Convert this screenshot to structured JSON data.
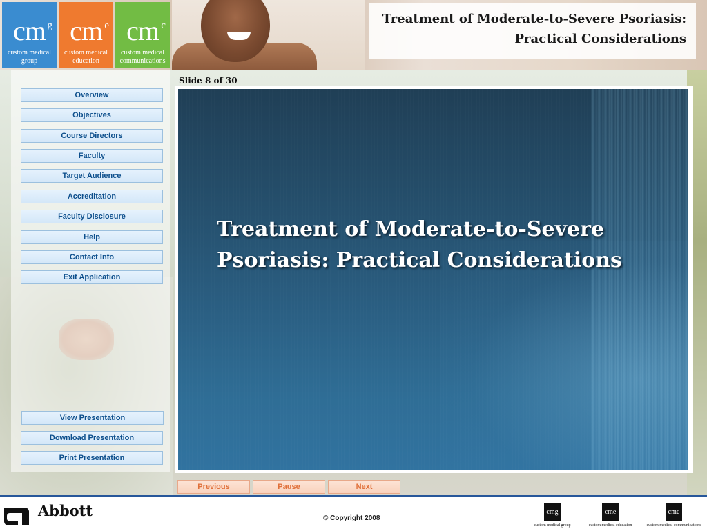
{
  "header": {
    "title_line1": "Treatment of Moderate-to-Severe Psoriasis:",
    "title_line2": "Practical Considerations",
    "logos": [
      {
        "mark": "cm",
        "sup": "g",
        "line1": "custom medical",
        "line2": "group",
        "color": "#3a8cd0"
      },
      {
        "mark": "cm",
        "sup": "e",
        "line1": "custom medical",
        "line2": "education",
        "color": "#ef7a2f"
      },
      {
        "mark": "cm",
        "sup": "c",
        "line1": "custom medical",
        "line2": "communications",
        "color": "#72bc44"
      }
    ]
  },
  "sidebar": {
    "nav": [
      "Overview",
      "Objectives",
      "Course Directors",
      "Faculty",
      "Target Audience",
      "Accreditation",
      "Faculty Disclosure",
      "Help",
      "Contact Info",
      "Exit Application"
    ],
    "actions": [
      "View Presentation",
      "Download Presentation",
      "Print Presentation"
    ]
  },
  "slide": {
    "counter": "Slide 8 of 30",
    "title_line1": "Treatment of Moderate-to-Severe",
    "title_line2": "Psoriasis: Practical Considerations"
  },
  "controls": {
    "previous": "Previous",
    "pause": "Pause",
    "next": "Next"
  },
  "footer": {
    "brand": "Abbott",
    "copyright": "© Copyright  2008",
    "mini_logos": [
      {
        "mark": "cmg",
        "caption": "custom medical group"
      },
      {
        "mark": "cme",
        "caption": "custom medical education"
      },
      {
        "mark": "cmc",
        "caption": "custom medical communications"
      }
    ]
  },
  "colors": {
    "nav_text": "#0d4f8c",
    "control_text": "#e0703a",
    "footer_rule": "#27579a"
  }
}
